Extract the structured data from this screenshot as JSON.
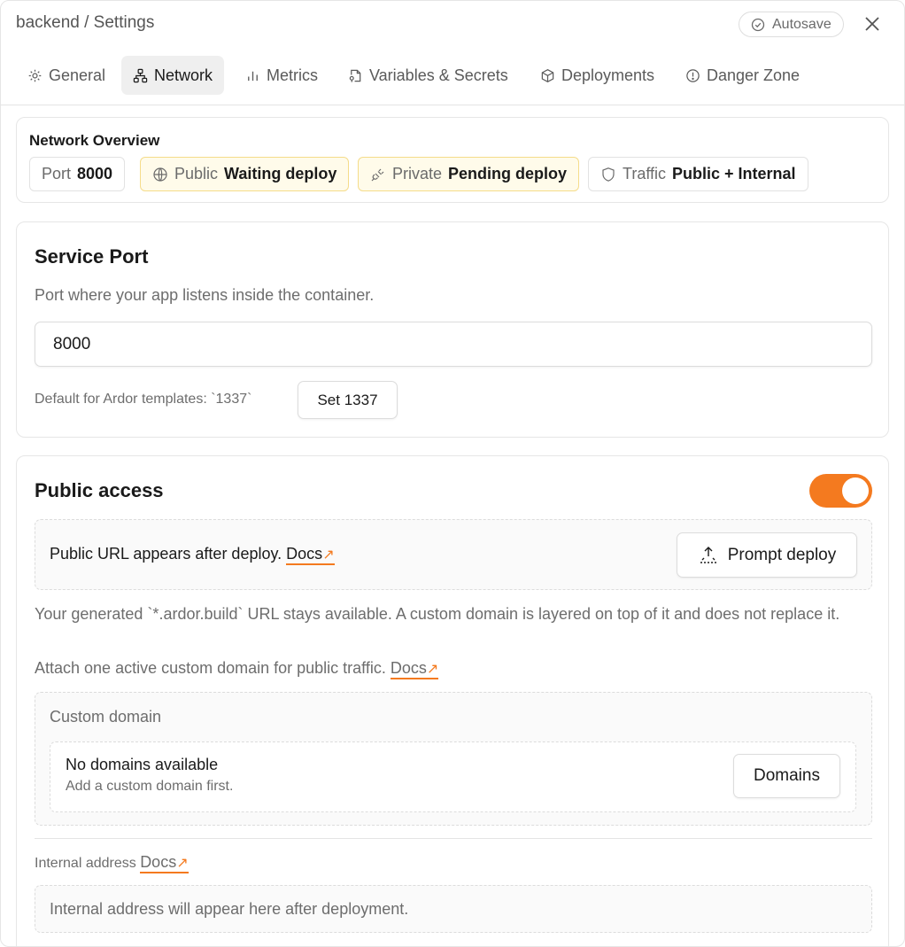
{
  "header": {
    "breadcrumb": "backend / Settings",
    "autosave_label": "Autosave"
  },
  "tabs": [
    {
      "label": "General",
      "icon": "gear-icon"
    },
    {
      "label": "Network",
      "icon": "network-icon",
      "active": true
    },
    {
      "label": "Metrics",
      "icon": "metrics-icon"
    },
    {
      "label": "Variables & Secrets",
      "icon": "file-key-icon"
    },
    {
      "label": "Deployments",
      "icon": "cube-icon"
    },
    {
      "label": "Danger Zone",
      "icon": "alert-circle-icon"
    }
  ],
  "overview": {
    "title": "Network Overview",
    "port": {
      "label": "Port",
      "value": "8000"
    },
    "public": {
      "label": "Public",
      "value": "Waiting deploy"
    },
    "private": {
      "label": "Private",
      "value": "Pending deploy"
    },
    "traffic": {
      "label": "Traffic",
      "value": "Public + Internal"
    }
  },
  "service_port": {
    "title": "Service Port",
    "description": "Port where your app listens inside the container.",
    "value": "8000",
    "default_text": "Default for Ardor templates: `1337`",
    "set_button": "Set 1337"
  },
  "public_access": {
    "title": "Public access",
    "enabled": true,
    "url_notice": "Public URL appears after deploy.",
    "docs_label": "Docs",
    "prompt_deploy_button": "Prompt deploy",
    "generated_url_text": "Your generated `*.ardor.build` URL stays available. A custom domain is layered on top of it and does not replace it.",
    "attach_text": "Attach one active custom domain for public traffic.",
    "custom_domain": {
      "title": "Custom domain",
      "empty_title": "No domains available",
      "empty_subtitle": "Add a custom domain first.",
      "domains_button": "Domains"
    },
    "internal": {
      "label": "Internal address",
      "placeholder": "Internal address will appear here after deployment."
    }
  },
  "colors": {
    "accent": "#f47a1f",
    "warning_bg": "#fffbea",
    "warning_border": "#f5dc8a"
  }
}
